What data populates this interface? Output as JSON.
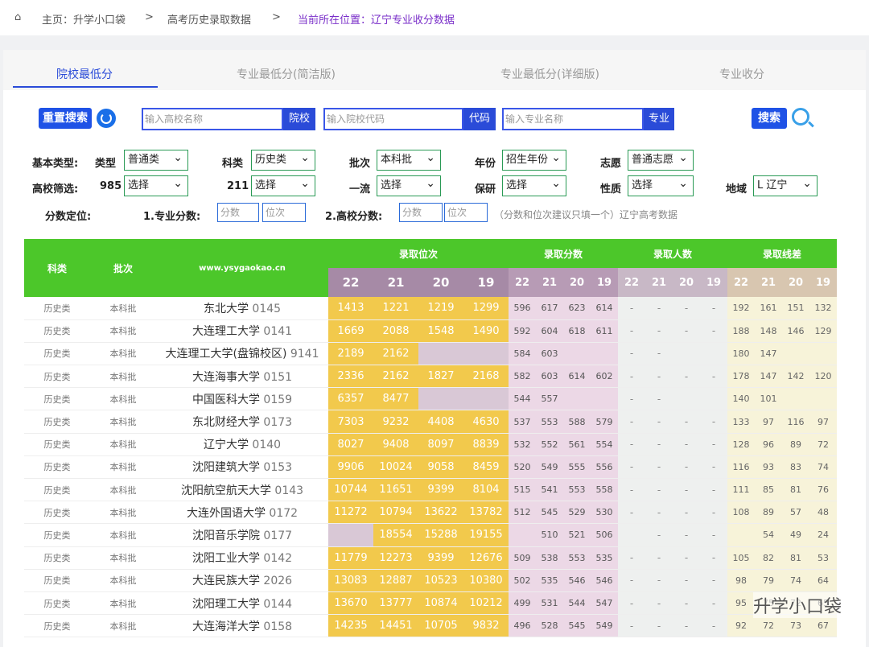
{
  "breadcrumb": {
    "home": "主页：升学小口袋",
    "sep": ">",
    "mid": "高考历史录取数据",
    "current": "当前所在位置：辽宁专业收分数据"
  },
  "tabs": [
    "院校最低分",
    "专业最低分(简洁版)",
    "专业最低分(详细版)",
    "专业收分"
  ],
  "search": {
    "reset": "重置搜索",
    "school_ph": "输入高校名称",
    "school_tag": "院校",
    "code_ph": "输入院校代码",
    "code_tag": "代码",
    "major_ph": "输入专业名称",
    "major_tag": "专业",
    "search": "搜索"
  },
  "filters": {
    "basic_label": "基本类型:",
    "type_label": "类型",
    "type_val": "普通类",
    "subject_label": "科类",
    "subject_val": "历史类",
    "batch_label": "批次",
    "batch_val": "本科批",
    "year_label": "年份",
    "year_val": "招生年份",
    "wish_label": "志愿",
    "wish_val": "普通志愿",
    "school_label": "高校筛选:",
    "985": "985",
    "985_val": "选择",
    "211": "211",
    "211_val": "选择",
    "first_label": "一流",
    "first_val": "选择",
    "baoyan_label": "保研",
    "baoyan_val": "选择",
    "nature_label": "性质",
    "nature_val": "选择",
    "region_label": "地域",
    "region_val": "L 辽宁",
    "score_label": "分数定位:",
    "major_score": "1.专业分数:",
    "school_score": "2.高校分数:",
    "score_ph": "分数",
    "rank_ph": "位次",
    "note": "（分数和位次建议只填一个）辽宁高考数据"
  },
  "table": {
    "h_subject": "科类",
    "h_batch": "批次",
    "h_site": "www.ysygaokao.cn",
    "h_rank": "录取位次",
    "h_score": "录取分数",
    "h_count": "录取人数",
    "h_diff": "录取线差",
    "years": [
      "22",
      "21",
      "20",
      "19"
    ],
    "rows": [
      {
        "subject": "历史类",
        "batch": "本科批",
        "school": "东北大学",
        "code": "0145",
        "rank": [
          "1413",
          "1221",
          "1219",
          "1299"
        ],
        "score": [
          "596",
          "617",
          "623",
          "614"
        ],
        "count": [
          "-",
          "-",
          "-",
          "-"
        ],
        "diff": [
          "192",
          "161",
          "151",
          "132"
        ]
      },
      {
        "subject": "历史类",
        "batch": "本科批",
        "school": "大连理工大学",
        "code": "0141",
        "rank": [
          "1669",
          "2088",
          "1548",
          "1490"
        ],
        "score": [
          "592",
          "604",
          "618",
          "611"
        ],
        "count": [
          "-",
          "-",
          "-",
          "-"
        ],
        "diff": [
          "188",
          "148",
          "146",
          "129"
        ]
      },
      {
        "subject": "历史类",
        "batch": "本科批",
        "school": "大连理工大学(盘锦校区)",
        "code": "9141",
        "rank": [
          "2189",
          "2162",
          "",
          ""
        ],
        "score": [
          "584",
          "603",
          "",
          ""
        ],
        "count": [
          "-",
          "-",
          "",
          ""
        ],
        "diff": [
          "180",
          "147",
          "",
          ""
        ]
      },
      {
        "subject": "历史类",
        "batch": "本科批",
        "school": "大连海事大学",
        "code": "0151",
        "rank": [
          "2336",
          "2162",
          "1827",
          "2168"
        ],
        "score": [
          "582",
          "603",
          "614",
          "602"
        ],
        "count": [
          "-",
          "-",
          "-",
          "-"
        ],
        "diff": [
          "178",
          "147",
          "142",
          "120"
        ]
      },
      {
        "subject": "历史类",
        "batch": "本科批",
        "school": "中国医科大学",
        "code": "0159",
        "rank": [
          "6357",
          "8477",
          "",
          ""
        ],
        "score": [
          "544",
          "557",
          "",
          ""
        ],
        "count": [
          "-",
          "-",
          "",
          ""
        ],
        "diff": [
          "140",
          "101",
          "",
          ""
        ]
      },
      {
        "subject": "历史类",
        "batch": "本科批",
        "school": "东北财经大学",
        "code": "0173",
        "rank": [
          "7303",
          "9232",
          "4408",
          "4630"
        ],
        "score": [
          "537",
          "553",
          "588",
          "579"
        ],
        "count": [
          "-",
          "-",
          "-",
          "-"
        ],
        "diff": [
          "133",
          "97",
          "116",
          "97"
        ]
      },
      {
        "subject": "历史类",
        "batch": "本科批",
        "school": "辽宁大学",
        "code": "0140",
        "rank": [
          "8027",
          "9408",
          "8097",
          "8839"
        ],
        "score": [
          "532",
          "552",
          "561",
          "554"
        ],
        "count": [
          "-",
          "-",
          "-",
          "-"
        ],
        "diff": [
          "128",
          "96",
          "89",
          "72"
        ]
      },
      {
        "subject": "历史类",
        "batch": "本科批",
        "school": "沈阳建筑大学",
        "code": "0153",
        "rank": [
          "9906",
          "10024",
          "9058",
          "8459"
        ],
        "score": [
          "520",
          "549",
          "555",
          "556"
        ],
        "count": [
          "-",
          "-",
          "-",
          "-"
        ],
        "diff": [
          "116",
          "93",
          "83",
          "74"
        ]
      },
      {
        "subject": "历史类",
        "batch": "本科批",
        "school": "沈阳航空航天大学",
        "code": "0143",
        "rank": [
          "10744",
          "11651",
          "9399",
          "8104"
        ],
        "score": [
          "515",
          "541",
          "553",
          "558"
        ],
        "count": [
          "-",
          "-",
          "-",
          "-"
        ],
        "diff": [
          "111",
          "85",
          "81",
          "76"
        ]
      },
      {
        "subject": "历史类",
        "batch": "本科批",
        "school": "大连外国语大学",
        "code": "0172",
        "rank": [
          "11272",
          "10794",
          "13622",
          "13782"
        ],
        "score": [
          "512",
          "545",
          "529",
          "530"
        ],
        "count": [
          "-",
          "-",
          "-",
          "-"
        ],
        "diff": [
          "108",
          "89",
          "57",
          "48"
        ]
      },
      {
        "subject": "历史类",
        "batch": "本科批",
        "school": "沈阳音乐学院",
        "code": "0177",
        "rank": [
          "",
          "18554",
          "15288",
          "19155"
        ],
        "score": [
          "",
          "510",
          "521",
          "506"
        ],
        "count": [
          "",
          "-",
          "-",
          "-"
        ],
        "diff": [
          "",
          "54",
          "49",
          "24"
        ]
      },
      {
        "subject": "历史类",
        "batch": "本科批",
        "school": "沈阳工业大学",
        "code": "0142",
        "rank": [
          "11779",
          "12273",
          "9399",
          "12676"
        ],
        "score": [
          "509",
          "538",
          "553",
          "535"
        ],
        "count": [
          "-",
          "-",
          "-",
          "-"
        ],
        "diff": [
          "105",
          "82",
          "81",
          "53"
        ]
      },
      {
        "subject": "历史类",
        "batch": "本科批",
        "school": "大连民族大学",
        "code": "2026",
        "rank": [
          "13083",
          "12887",
          "10523",
          "10380"
        ],
        "score": [
          "502",
          "535",
          "546",
          "546"
        ],
        "count": [
          "-",
          "-",
          "-",
          "-"
        ],
        "diff": [
          "98",
          "79",
          "74",
          "64"
        ]
      },
      {
        "subject": "历史类",
        "batch": "本科批",
        "school": "沈阳理工大学",
        "code": "0144",
        "rank": [
          "13670",
          "13777",
          "10874",
          "10212"
        ],
        "score": [
          "499",
          "531",
          "544",
          "547"
        ],
        "count": [
          "-",
          "-",
          "-",
          "-"
        ],
        "diff": [
          "95",
          "75",
          "72",
          "65"
        ]
      },
      {
        "subject": "历史类",
        "batch": "本科批",
        "school": "大连海洋大学",
        "code": "0158",
        "rank": [
          "14235",
          "14451",
          "10705",
          "9832"
        ],
        "score": [
          "496",
          "528",
          "545",
          "549"
        ],
        "count": [
          "-",
          "-",
          "-",
          "-"
        ],
        "diff": [
          "92",
          "72",
          "73",
          "67"
        ]
      }
    ]
  },
  "watermark": "升学小口袋"
}
